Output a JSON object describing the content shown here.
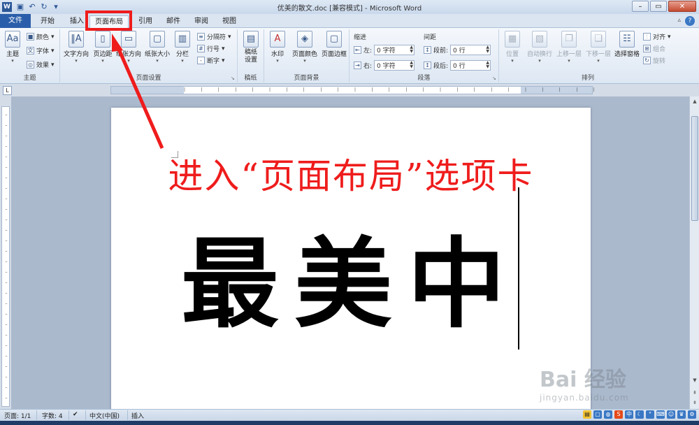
{
  "window": {
    "title": "优美的散文.doc [兼容模式] - Microsoft Word",
    "app_icon": "W"
  },
  "tabs": [
    "文件",
    "开始",
    "插入",
    "页面布局",
    "引用",
    "邮件",
    "审阅",
    "视图"
  ],
  "active_tab": "页面布局",
  "ribbon": {
    "theme": {
      "label": "主题",
      "btn": "主题",
      "colors": "颜色",
      "fonts": "字体",
      "effects": "效果"
    },
    "page_setup": {
      "label": "页面设置",
      "text_direction": "文字方向",
      "margins": "页边距",
      "orientation": "纸张方向",
      "size": "纸张大小",
      "columns": "分栏",
      "breaks": "分隔符",
      "line_numbers": "行号",
      "hyphenation": "断字"
    },
    "manuscript": {
      "label": "稿纸",
      "btn": "稿纸设置"
    },
    "background": {
      "label": "页面背景",
      "watermark": "水印",
      "page_color": "页面颜色",
      "page_border": "页面边框"
    },
    "paragraph": {
      "label": "段落",
      "indent_title": "缩进",
      "left": "左:",
      "right": "右:",
      "left_value": "0 字符",
      "right_value": "0 字符",
      "spacing_title": "间距",
      "before": "段前:",
      "after": "段后:",
      "before_value": "0 行",
      "after_value": "0 行"
    },
    "arrange": {
      "label": "排列",
      "position": "位置",
      "wrap": "自动换行",
      "forward": "上移一层",
      "backward": "下移一层",
      "selection_pane": "选择窗格",
      "align": "对齐",
      "group": "组合",
      "rotate": "旋转"
    }
  },
  "document": {
    "annotation": "进入“页面布局”选项卡",
    "body_text": "最美中"
  },
  "status": {
    "page": "页面: 1/1",
    "words": "字数: 4",
    "language": "中文(中国)",
    "mode": "插入"
  },
  "watermark": {
    "line1": "Bai 经验",
    "line2": "jingyan.baidu.com"
  },
  "colors": {
    "annotation": "#ef1c1c",
    "file_tab": "#2b5eaa"
  }
}
